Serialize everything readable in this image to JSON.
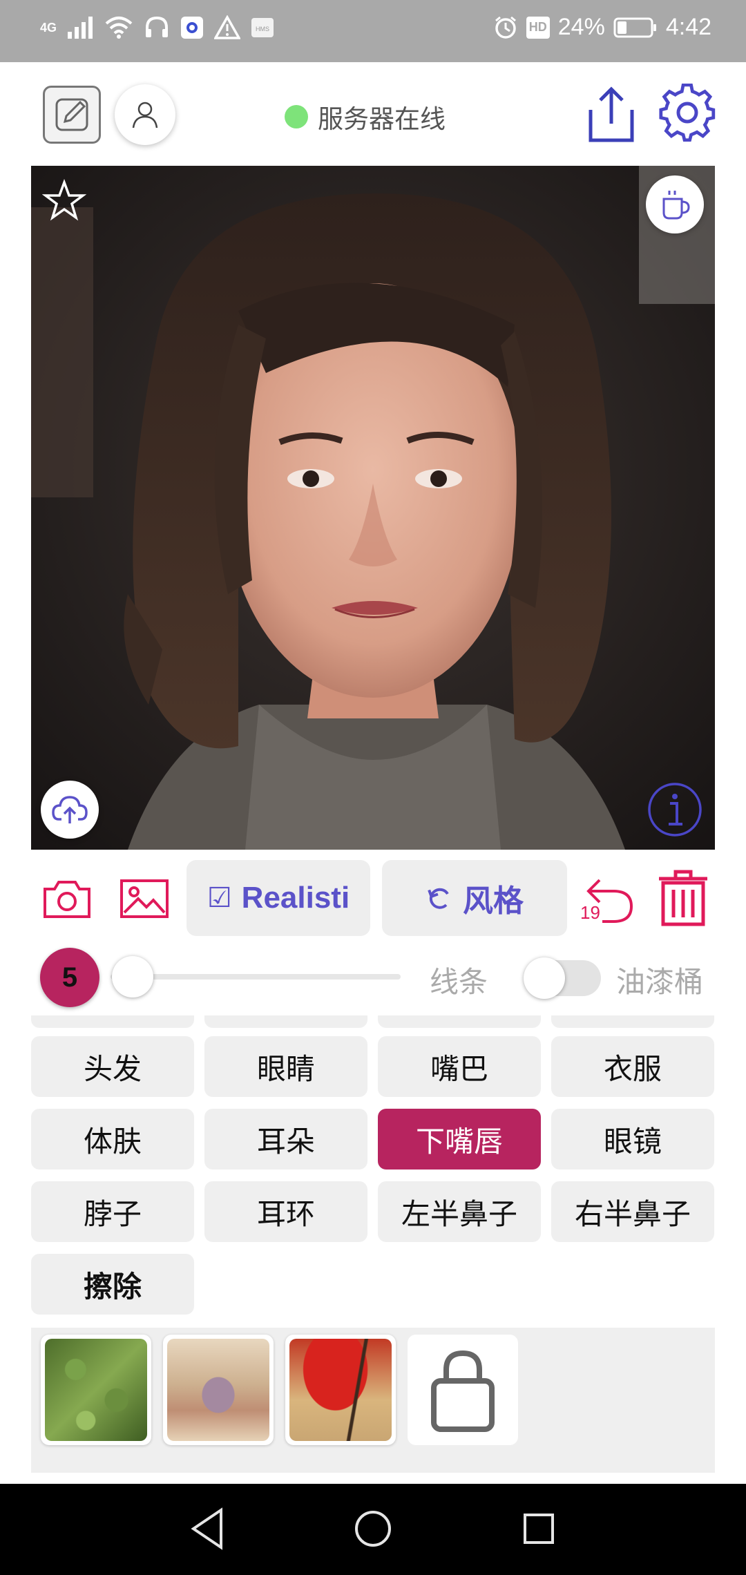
{
  "status_bar": {
    "network": "4G",
    "battery": "24%",
    "time": "4:42",
    "hd": "HD",
    "icons": [
      "signal-icon",
      "wifi-icon",
      "headset-icon",
      "app-icon",
      "warning-icon",
      "hms-icon",
      "alarm-icon",
      "battery-icon"
    ]
  },
  "header": {
    "server_status": "服务器在线",
    "server_status_color": "#7ee37a",
    "icons": [
      "sketch-icon",
      "user-icon",
      "share-icon",
      "gear-icon"
    ]
  },
  "photo": {
    "icons": [
      "star-icon",
      "coffee-cup-icon",
      "upload-cloud-icon",
      "info-icon"
    ]
  },
  "toolbar": {
    "style_label": "Realisti",
    "style_checkbox": "☑",
    "restyle_label": "风格",
    "undo_count": "19",
    "accent_color": "#e01a5a",
    "purple_color": "#5b52c9",
    "icons": [
      "camera-icon",
      "image-icon",
      "undo-icon",
      "trash-icon"
    ]
  },
  "brush": {
    "size": "5",
    "line_label": "线条",
    "fill_label": "油漆桶",
    "slider_value": 0,
    "fill_enabled": false
  },
  "parts": {
    "rows": [
      [
        "头发",
        "眼睛",
        "嘴巴",
        "衣服"
      ],
      [
        "体肤",
        "耳朵",
        "下嘴唇",
        "眼镜"
      ],
      [
        "脖子",
        "耳环",
        "左半鼻子",
        "右半鼻子"
      ],
      [
        "擦除"
      ]
    ],
    "selected": "下嘴唇"
  },
  "textures": {
    "icons": [
      "texture-grass",
      "texture-flower-sand",
      "texture-red-flowers",
      "shop-bag-icon"
    ]
  },
  "navbar": {
    "icons": [
      "back-icon",
      "home-icon",
      "recents-icon"
    ]
  }
}
